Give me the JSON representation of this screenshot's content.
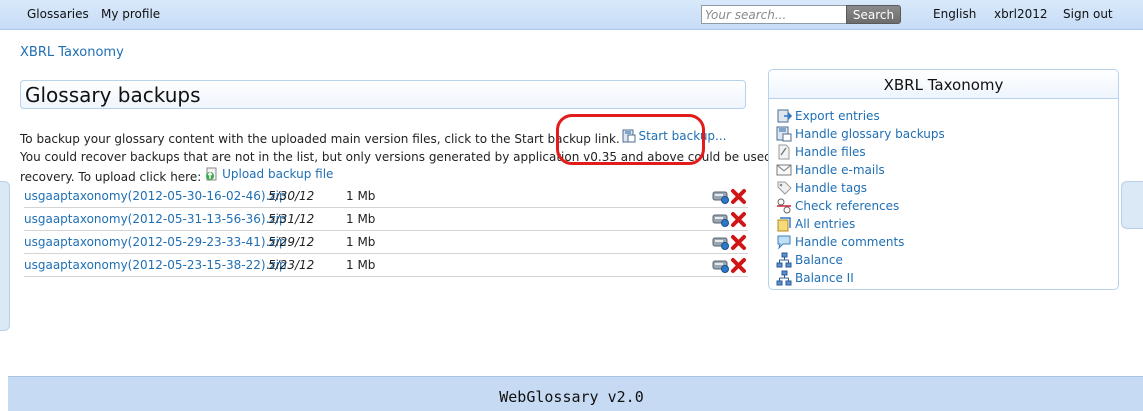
{
  "topbar": {
    "nav": [
      "Glossaries",
      "My profile"
    ],
    "search_placeholder": "Your search...",
    "search_button": "Search",
    "language": "English",
    "user": "xbrl2012",
    "signout": "Sign out"
  },
  "breadcrumb": "XBRL Taxonomy",
  "page_title": "Glossary backups",
  "description": {
    "line1": "To backup your glossary content with the uploaded main version files, click to the Start backup link.",
    "start_backup": "Start backup...",
    "line2": "You could recover backups that are not in the list, but only versions generated by application v0.35 and above could be used for",
    "line3": "recovery. To upload click here:",
    "upload": "Upload backup file"
  },
  "backups": [
    {
      "file": "usgaaptaxonomy(2012-05-30-16-02-46).zip",
      "date": "5/30/12",
      "size": "1 Mb"
    },
    {
      "file": "usgaaptaxonomy(2012-05-31-13-56-36).zip",
      "date": "5/31/12",
      "size": "1 Mb"
    },
    {
      "file": "usgaaptaxonomy(2012-05-29-23-33-41).zip",
      "date": "5/29/12",
      "size": "1 Mb"
    },
    {
      "file": "usgaaptaxonomy(2012-05-23-15-38-22).zip",
      "date": "5/23/12",
      "size": "1 Mb"
    }
  ],
  "panel": {
    "title": "XBRL Taxonomy",
    "items": [
      {
        "label": "Export entries",
        "icon": "export-icon"
      },
      {
        "label": "Handle glossary backups",
        "icon": "backup-icon"
      },
      {
        "label": "Handle files",
        "icon": "files-icon"
      },
      {
        "label": "Handle e-mails",
        "icon": "email-icon"
      },
      {
        "label": "Handle tags",
        "icon": "tag-icon"
      },
      {
        "label": "Check references",
        "icon": "references-icon"
      },
      {
        "label": "All entries",
        "icon": "entries-icon"
      },
      {
        "label": "Handle comments",
        "icon": "comment-icon"
      },
      {
        "label": "Balance",
        "icon": "hierarchy-icon"
      },
      {
        "label": "Balance II",
        "icon": "hierarchy-icon"
      }
    ]
  },
  "footer": "WebGlossary v2.0",
  "colors": {
    "link": "#1f6fb4",
    "topbar": "#c6dcf6",
    "annotation": "#e21b1b",
    "delete": "#d01515"
  }
}
